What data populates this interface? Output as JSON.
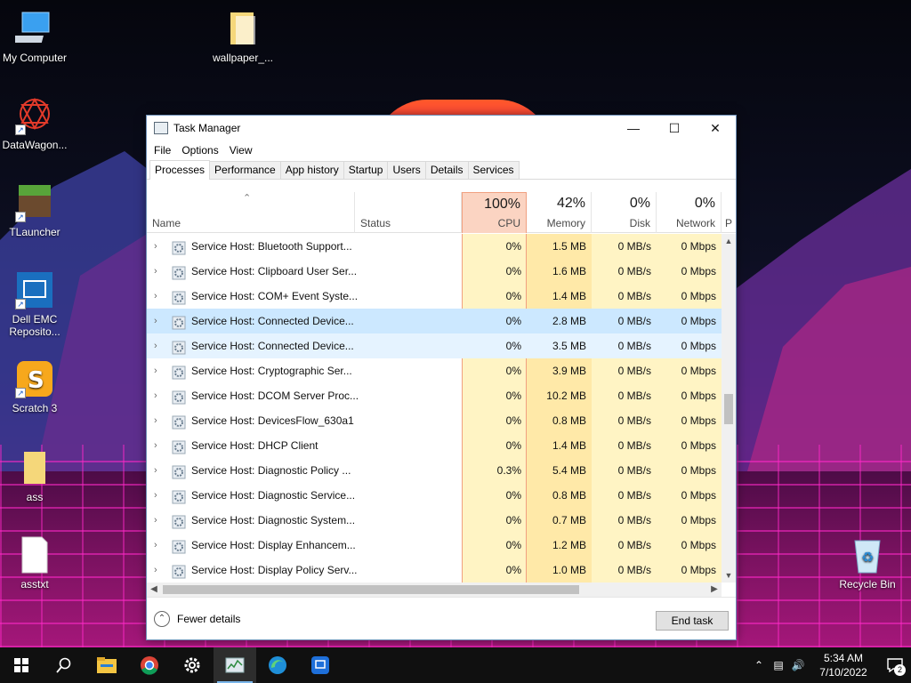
{
  "desktop": {
    "icons": [
      {
        "label": "My Computer",
        "icon": "computer-icon"
      },
      {
        "label": "wallpaper_...",
        "icon": "folder-icon"
      },
      {
        "label": "DataWagon...",
        "icon": "datawagon-icon"
      },
      {
        "label": "TLauncher",
        "icon": "minecraft-icon"
      },
      {
        "label": "Dell EMC Reposito...",
        "icon": "dell-folder-icon"
      },
      {
        "label": "Scratch 3",
        "icon": "scratch-icon"
      },
      {
        "label": "ass",
        "icon": "folder-icon"
      },
      {
        "label": "asstxt",
        "icon": "text-file-icon"
      },
      {
        "label": "Recycle Bin",
        "icon": "recycle-bin-icon"
      }
    ]
  },
  "window": {
    "title": "Task Manager",
    "menu": [
      "File",
      "Options",
      "View"
    ],
    "tabs": [
      "Processes",
      "Performance",
      "App history",
      "Startup",
      "Users",
      "Details",
      "Services"
    ],
    "active_tab": "Processes",
    "columns": {
      "name": "Name",
      "status": "Status",
      "cpu": {
        "pct": "100%",
        "label": "CPU"
      },
      "memory": {
        "pct": "42%",
        "label": "Memory"
      },
      "disk": {
        "pct": "0%",
        "label": "Disk"
      },
      "network": {
        "pct": "0%",
        "label": "Network"
      },
      "power": "P"
    },
    "rows": [
      {
        "name": "Service Host: Bluetooth Support...",
        "cpu": "0%",
        "mem": "1.5 MB",
        "disk": "0 MB/s",
        "net": "0 Mbps"
      },
      {
        "name": "Service Host: Clipboard User Ser...",
        "cpu": "0%",
        "mem": "1.6 MB",
        "disk": "0 MB/s",
        "net": "0 Mbps"
      },
      {
        "name": "Service Host: COM+ Event Syste...",
        "cpu": "0%",
        "mem": "1.4 MB",
        "disk": "0 MB/s",
        "net": "0 Mbps"
      },
      {
        "name": "Service Host: Connected Device...",
        "cpu": "0%",
        "mem": "2.8 MB",
        "disk": "0 MB/s",
        "net": "0 Mbps"
      },
      {
        "name": "Service Host: Connected Device...",
        "cpu": "0%",
        "mem": "3.5 MB",
        "disk": "0 MB/s",
        "net": "0 Mbps"
      },
      {
        "name": "Service Host: Cryptographic Ser...",
        "cpu": "0%",
        "mem": "3.9 MB",
        "disk": "0 MB/s",
        "net": "0 Mbps"
      },
      {
        "name": "Service Host: DCOM Server Proc...",
        "cpu": "0%",
        "mem": "10.2 MB",
        "disk": "0 MB/s",
        "net": "0 Mbps"
      },
      {
        "name": "Service Host: DevicesFlow_630a1",
        "cpu": "0%",
        "mem": "0.8 MB",
        "disk": "0 MB/s",
        "net": "0 Mbps"
      },
      {
        "name": "Service Host: DHCP Client",
        "cpu": "0%",
        "mem": "1.4 MB",
        "disk": "0 MB/s",
        "net": "0 Mbps"
      },
      {
        "name": "Service Host: Diagnostic Policy ...",
        "cpu": "0.3%",
        "mem": "5.4 MB",
        "disk": "0 MB/s",
        "net": "0 Mbps"
      },
      {
        "name": "Service Host: Diagnostic Service...",
        "cpu": "0%",
        "mem": "0.8 MB",
        "disk": "0 MB/s",
        "net": "0 Mbps"
      },
      {
        "name": "Service Host: Diagnostic System...",
        "cpu": "0%",
        "mem": "0.7 MB",
        "disk": "0 MB/s",
        "net": "0 Mbps"
      },
      {
        "name": "Service Host: Display Enhancem...",
        "cpu": "0%",
        "mem": "1.2 MB",
        "disk": "0 MB/s",
        "net": "0 Mbps"
      },
      {
        "name": "Service Host: Display Policy Serv...",
        "cpu": "0%",
        "mem": "1.0 MB",
        "disk": "0 MB/s",
        "net": "0 Mbps"
      }
    ],
    "fewer_details": "Fewer details",
    "end_task": "End task"
  },
  "taskbar": {
    "apps": [
      "start-icon",
      "search-icon",
      "file-explorer-icon",
      "chrome-icon",
      "settings-icon",
      "task-manager-icon",
      "edge-icon",
      "remote-desktop-icon"
    ],
    "time": "5:34 AM",
    "date": "7/10/2022",
    "notification_count": "2"
  }
}
